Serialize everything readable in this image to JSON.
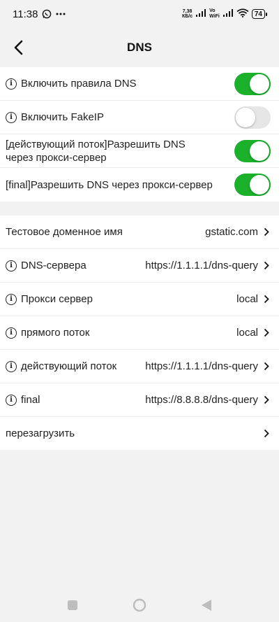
{
  "statusbar": {
    "time": "11:38",
    "netspeed_value": "7,38",
    "netspeed_unit": "КБ/с",
    "vowifi_top": "Vo",
    "vowifi_bottom": "WiFi",
    "battery": "74"
  },
  "header": {
    "title": "DNS"
  },
  "toggles": [
    {
      "label": "Включить правила DNS",
      "on": true,
      "info": true
    },
    {
      "label": "Включить FakeIP",
      "on": false,
      "info": true
    },
    {
      "label": "[действующий поток]Разрешить DNS через прокси-сервер",
      "on": true,
      "info": false
    },
    {
      "label": "[final]Разрешить DNS через прокси-сервер",
      "on": true,
      "info": false
    }
  ],
  "settings": [
    {
      "label": "Тестовое доменное имя",
      "value": "gstatic.com",
      "info": false
    },
    {
      "label": "DNS-сервера",
      "value": "https://1.1.1.1/dns-query",
      "info": true
    },
    {
      "label": "Прокси сервер",
      "value": "local",
      "info": true
    },
    {
      "label": "прямого поток",
      "value": "local",
      "info": true
    },
    {
      "label": "действующий поток",
      "value": "https://1.1.1.1/dns-query",
      "info": true
    },
    {
      "label": "final",
      "value": "https://8.8.8.8/dns-query",
      "info": true
    },
    {
      "label": "перезагрузить",
      "value": "",
      "info": false
    }
  ],
  "colors": {
    "switch_on": "#1bb12a",
    "switch_off": "#e6e6e6",
    "background": "#f2f2f2"
  },
  "icons": {
    "info": "info-icon",
    "chevron": "chevron-right-icon",
    "back": "back-arrow-icon"
  }
}
